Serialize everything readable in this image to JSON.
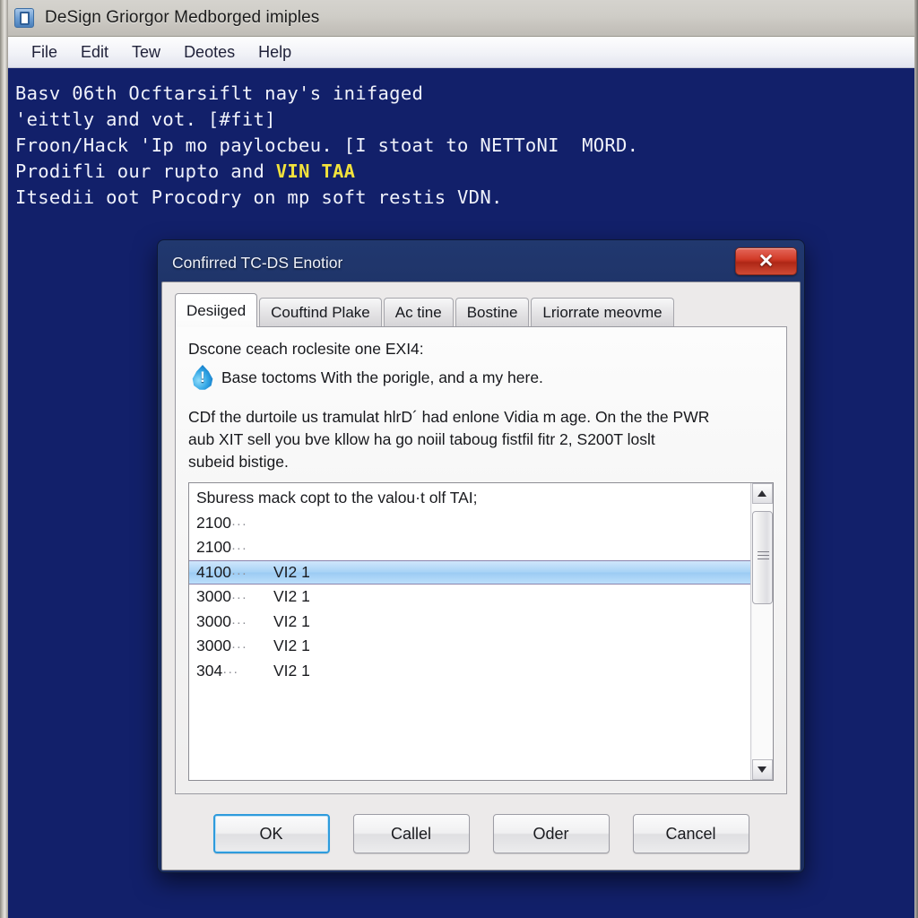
{
  "window": {
    "title": "DeSign Griorgor Medborged imiples",
    "icon": "app-document-icon",
    "menu": [
      "File",
      "Edit",
      "Tew",
      "Deotes",
      "Help"
    ]
  },
  "document": {
    "lines": [
      {
        "text": "Basv 06th Ocftarsiflt nay's inifaged"
      },
      {
        "text": "'eittly and vot. [#fit]"
      },
      {
        "text": "Froon/Hack 'Ip mo paylocbeu. [I stoat to NETToNI  MORD."
      },
      {
        "pre": "Prodifli our rupto and ",
        "highlight": "VIN TAA",
        "post": ""
      },
      {
        "text": "Itsedii oot Procodry on mp soft restis VDN."
      }
    ],
    "highlight_color": "#f2e23c"
  },
  "dialog": {
    "title": "Confirred TC-DS Enotior",
    "close_label": "✕",
    "tabs": [
      {
        "label": "Desiiged",
        "active": true
      },
      {
        "label": "Couftind Plake",
        "active": false
      },
      {
        "label": "Ac tine",
        "active": false
      },
      {
        "label": "Bostine",
        "active": false
      },
      {
        "label": "Lriorrate meovme",
        "active": false
      }
    ],
    "intro": "Dscone ceach roclesite one EXI4:",
    "note": {
      "icon": "info-droplet-icon",
      "text": "Base toctoms With the porigle, and a my here."
    },
    "paragraph": [
      "CDf the durtoile us tramulat hlrD´ had enlone Vidia m age. On the the PWR",
      "aub XIT sell you bve kllow ha go noiil taboug fistfil fitr 2, S200T loslt",
      "subeid bistige."
    ],
    "list": {
      "header": "Sburess mack copt to the valou·t olf TAI;",
      "rows": [
        {
          "col1": "2100",
          "dots": "···",
          "col2": "",
          "selected": false
        },
        {
          "col1": "2100",
          "dots": "···",
          "col2": "",
          "selected": false
        },
        {
          "col1": "4100",
          "dots": "···",
          "col2": "VI2 1",
          "selected": true
        },
        {
          "col1": "3000",
          "dots": "···",
          "col2": "VI2 1",
          "selected": false
        },
        {
          "col1": "3000",
          "dots": "···",
          "col2": "VI2 1",
          "selected": false
        },
        {
          "col1": "3000",
          "dots": "···",
          "col2": "VI2 1",
          "selected": false
        },
        {
          "col1": "304",
          "dots": "···",
          "col2": "VI2 1",
          "selected": false
        }
      ],
      "selection_color": "#a8d3f6"
    },
    "buttons": [
      {
        "label": "OK",
        "focused": true
      },
      {
        "label": "Callel",
        "focused": false
      },
      {
        "label": "Oder",
        "focused": false
      },
      {
        "label": "Cancel",
        "focused": false
      }
    ]
  },
  "colors": {
    "document_background": "#12206a",
    "titlebar": "#cfcdc7",
    "dialog_frame": "#1b2e60",
    "close_button": "#d23b28"
  }
}
